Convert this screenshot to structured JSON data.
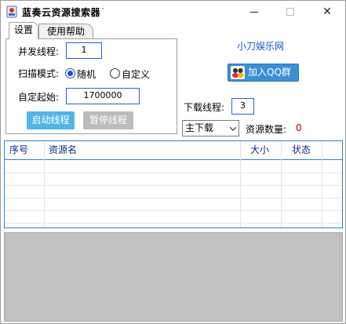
{
  "window": {
    "title": "蓝奏云资源搜索器",
    "close_glyph": "✕"
  },
  "tabs": [
    {
      "label": "设置",
      "active": true
    },
    {
      "label": "使用帮助",
      "active": false
    }
  ],
  "settings": {
    "threads_label": "并发线程:",
    "threads_value": "1",
    "scan_mode_label": "扫描模式:",
    "scan_mode_options": [
      {
        "label": "随机",
        "checked": true
      },
      {
        "label": "自定义",
        "checked": false
      }
    ],
    "start_label": "自定起始:",
    "start_value": "1700000",
    "start_button": "启动线程",
    "pause_button": "暂停线程"
  },
  "side": {
    "site_link": "小刀娱乐网",
    "qq_button": "加入QQ群",
    "download_threads_label": "下载线程:",
    "download_threads_value": "3",
    "download_source_selected": "主下载",
    "resource_count_label": "资源数量:",
    "resource_count_value": "0"
  },
  "table": {
    "columns": [
      "序号",
      "资源名",
      "大小",
      "状态"
    ],
    "rows": []
  },
  "icons": {
    "app": "app-icon",
    "qq": "qq-icon",
    "dropdown": "chevron-down-icon"
  },
  "colors": {
    "accent_blue": "#2f81c5",
    "start_button": "#4fb6e6",
    "pause_button": "#bcbcbc",
    "count_red": "#c00000",
    "link_blue": "#1a4fd0"
  }
}
